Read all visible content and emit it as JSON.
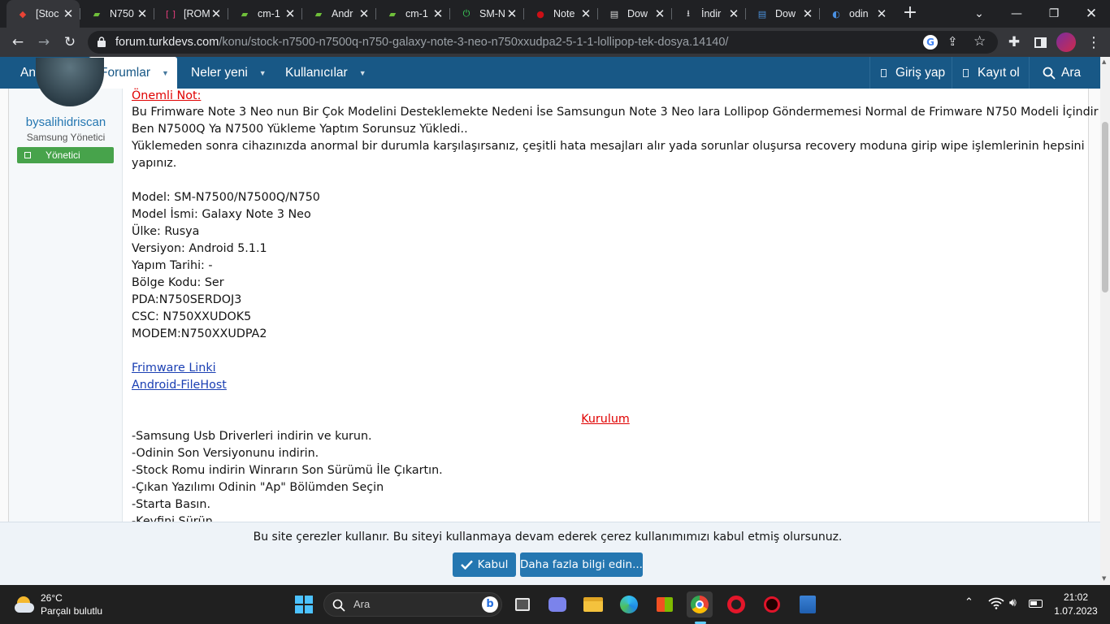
{
  "tabs": [
    {
      "title": "[Stoc",
      "icon": "turkdevs-icon",
      "color": "#ea4335"
    },
    {
      "title": "N750",
      "icon": "android-icon",
      "color": "#6fbf3a"
    },
    {
      "title": "[ROM",
      "icon": "bracket-icon",
      "color": "#e23d7a"
    },
    {
      "title": "cm-1",
      "icon": "android-icon",
      "color": "#6fbf3a"
    },
    {
      "title": "Andr",
      "icon": "android-icon",
      "color": "#6fbf3a"
    },
    {
      "title": "cm-1",
      "icon": "android-icon",
      "color": "#6fbf3a"
    },
    {
      "title": "SM-N",
      "icon": "power-icon",
      "color": "#3ddc5c"
    },
    {
      "title": "Note",
      "icon": "opera-icon",
      "color": "#cc0f16"
    },
    {
      "title": "Dow",
      "icon": "document-icon",
      "color": "#d9d9d9"
    },
    {
      "title": "İndir",
      "icon": "download-icon",
      "color": "#e8eaed"
    },
    {
      "title": "Dow",
      "icon": "document-icon",
      "color": "#4a8fd8"
    },
    {
      "title": "odin",
      "icon": "odin-icon",
      "color": "#4a90e2"
    }
  ],
  "url": {
    "domain": "forum.turkdevs.com",
    "path": "/konu/stock-n7500-n7500q-n750-galaxy-note-3-neo-n750xxudpa2-5-1-1-lollipop-tek-dosya.14140/"
  },
  "nav": {
    "home": "Ana sayfa",
    "forums": "Forumlar",
    "whats_new": "Neler yeni",
    "members": "Kullanıcılar",
    "login": "Giriş yap",
    "register": "Kayıt ol",
    "search": "Ara"
  },
  "user": {
    "name": "bysalihidriscan",
    "title": "Samsung Yönetici",
    "badge": "Yönetici"
  },
  "post": {
    "note_heading": "Önemli Not:",
    "note_lines": [
      "Bu Frimware Note 3 Neo nun Bir Çok Modelini Desteklemekte Nedeni İse Samsungun Note 3 Neo lara Lollipop Göndermemesi Normal de Frimware N750 Modeli İçindir",
      "Ben N7500Q Ya N7500 Yükleme Yaptım Sorunsuz Yükledi..",
      "Yüklemeden sonra cihazınızda anormal bir durumla karşılaşırsanız, çeşitli hata mesajları alır yada sorunlar oluşursa recovery moduna girip wipe işlemlerinin hepsini",
      "yapınız."
    ],
    "specs": [
      "Model: SM-N7500/N7500Q/N750",
      "Model İsmi: Galaxy Note 3 Neo",
      "Ülke: Rusya",
      "Versiyon: Android 5.1.1",
      "Yapım Tarihi: -",
      "Bölge Kodu: Ser",
      "PDA:N750SERDOJ3",
      "CSC: N750XXUDOK5",
      "MODEM:N750XXUDPA2"
    ],
    "links": [
      "Frimware Linki",
      "Android-FileHost"
    ],
    "install_heading": "Kurulum",
    "steps": [
      "-Samsung Usb Driverleri indirin ve kurun.",
      "-Odinin Son Versiyonunu indirin.",
      "-Stock Romu indirin Winrarın Son Sürümü İle Çıkartın.",
      "-Çıkan Yazılımı Odinin \"Ap\" Bölümden Seçin",
      "-Starta Basın.",
      "-Keyfini  Sürün."
    ]
  },
  "cookie": {
    "text": "Bu site çerezler kullanır. Bu siteyi kullanmaya devam ederek çerez kullanımımızı kabul etmiş olursunuz.",
    "accept": "Kabul",
    "more": "Daha fazla bilgi edin..."
  },
  "taskbar": {
    "weather_temp": "26°C",
    "weather_desc": "Parçalı bulutlu",
    "search_placeholder": "Ara",
    "time": "21:02",
    "date": "1.07.2023"
  },
  "colors": {
    "nav_bg": "#185886",
    "link_blue": "#2577b1",
    "badge_green": "#47a34b",
    "note_red": "#e00000"
  }
}
